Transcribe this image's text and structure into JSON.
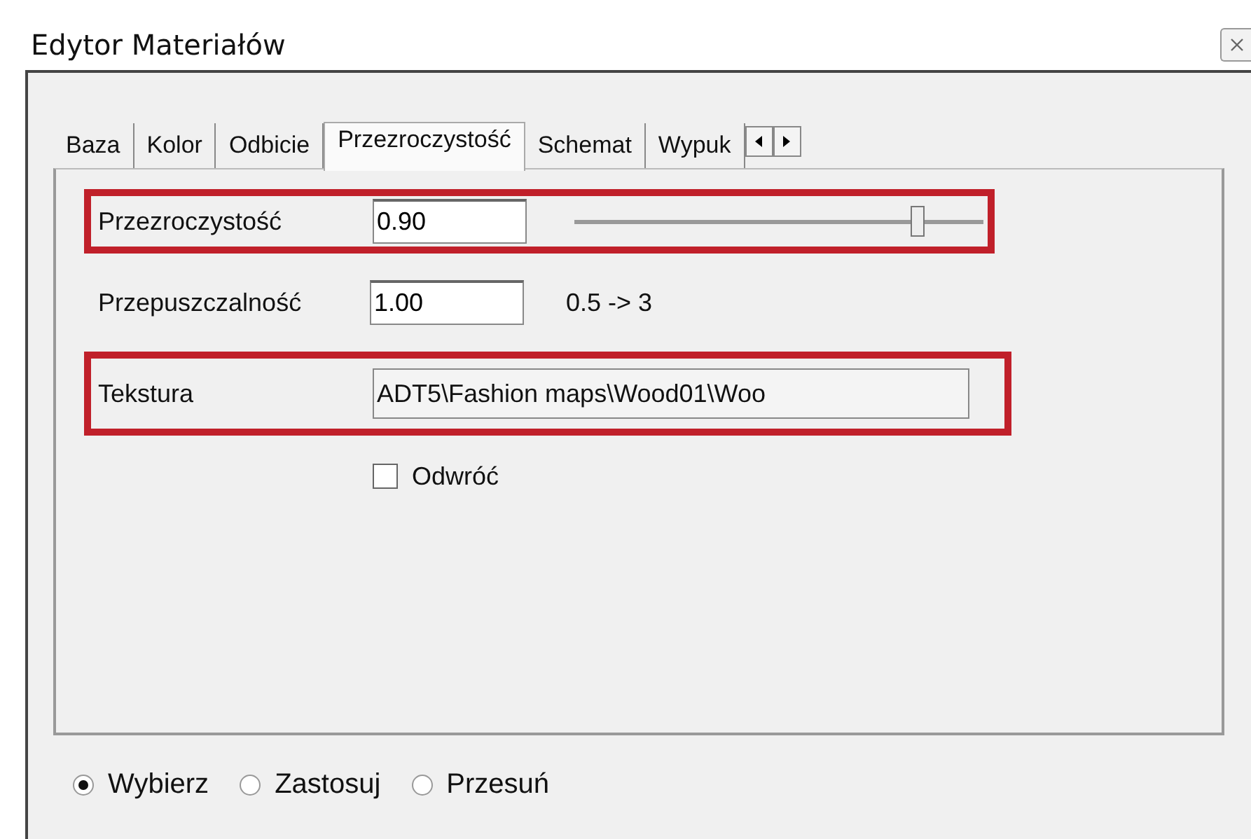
{
  "window": {
    "title": "Edytor Materiałów"
  },
  "tabs": [
    {
      "label": "Baza",
      "selected": false
    },
    {
      "label": "Kolor",
      "selected": false
    },
    {
      "label": "Odbicie",
      "selected": false
    },
    {
      "label": "Przezroczystość",
      "selected": true
    },
    {
      "label": "Schemat",
      "selected": false
    },
    {
      "label": "Wypuk",
      "selected": false
    }
  ],
  "rows": [
    {
      "kind": "slider",
      "label": "Przezroczystość",
      "value": "0.90",
      "level": 0.84,
      "highlighted": true
    },
    {
      "kind": "field",
      "label": "Przepuszczalność",
      "value": "1.00",
      "hint": "0.5 -> 3",
      "highlighted": false
    },
    {
      "kind": "file",
      "label": "Tekstura",
      "value": "ADT5\\Fashion maps\\Wood01\\Woo",
      "highlighted": true
    },
    {
      "kind": "checkbox",
      "label": "Odwróć",
      "checked": false,
      "highlighted": false
    }
  ],
  "modes": [
    {
      "label": "Wybierz",
      "selected": true
    },
    {
      "label": "Zastosuj",
      "selected": false
    },
    {
      "label": "Przesuń",
      "selected": false
    }
  ]
}
